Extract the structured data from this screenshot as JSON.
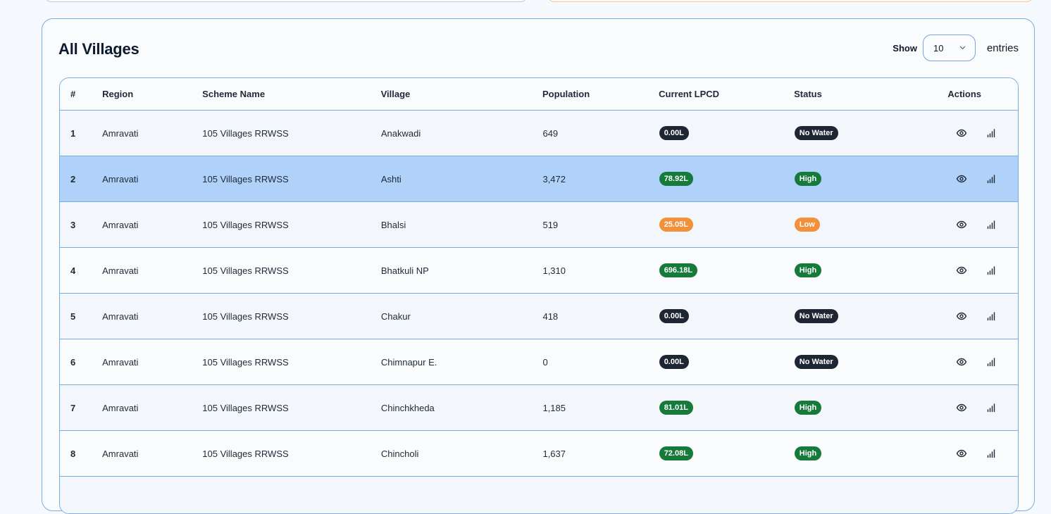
{
  "panel": {
    "title": "All Villages",
    "show_label": "Show",
    "entries_value": "10",
    "entries_label": "entries"
  },
  "table": {
    "headers": {
      "num": "#",
      "region": "Region",
      "scheme": "Scheme Name",
      "village": "Village",
      "population": "Population",
      "lpcd": "Current LPCD",
      "status": "Status",
      "actions": "Actions"
    },
    "rows": [
      {
        "num": "1",
        "region": "Amravati",
        "scheme": "105 Villages RRWSS",
        "village": "Anakwadi",
        "population": "649",
        "lpcd": "0.00L",
        "lpcd_color": "#1e2633",
        "status": "No Water",
        "status_color": "#1e2633"
      },
      {
        "num": "2",
        "region": "Amravati",
        "scheme": "105 Villages RRWSS",
        "village": "Ashti",
        "population": "3,472",
        "lpcd": "78.92L",
        "lpcd_color": "#157a3a",
        "status": "High",
        "status_color": "#157a3a"
      },
      {
        "num": "3",
        "region": "Amravati",
        "scheme": "105 Villages RRWSS",
        "village": "Bhalsi",
        "population": "519",
        "lpcd": "25.05L",
        "lpcd_color": "#f3913b",
        "status": "Low",
        "status_color": "#f3913b"
      },
      {
        "num": "4",
        "region": "Amravati",
        "scheme": "105 Villages RRWSS",
        "village": "Bhatkuli NP",
        "population": "1,310",
        "lpcd": "696.18L",
        "lpcd_color": "#157a3a",
        "status": "High",
        "status_color": "#157a3a"
      },
      {
        "num": "5",
        "region": "Amravati",
        "scheme": "105 Villages RRWSS",
        "village": "Chakur",
        "population": "418",
        "lpcd": "0.00L",
        "lpcd_color": "#1e2633",
        "status": "No Water",
        "status_color": "#1e2633"
      },
      {
        "num": "6",
        "region": "Amravati",
        "scheme": "105 Villages RRWSS",
        "village": "Chimnapur E.",
        "population": "0",
        "lpcd": "0.00L",
        "lpcd_color": "#1e2633",
        "status": "No Water",
        "status_color": "#1e2633"
      },
      {
        "num": "7",
        "region": "Amravati",
        "scheme": "105 Villages RRWSS",
        "village": "Chinchkheda",
        "population": "1,185",
        "lpcd": "81.01L",
        "lpcd_color": "#157a3a",
        "status": "High",
        "status_color": "#157a3a"
      },
      {
        "num": "8",
        "region": "Amravati",
        "scheme": "105 Villages RRWSS",
        "village": "Chincholi",
        "population": "1,637",
        "lpcd": "72.08L",
        "lpcd_color": "#157a3a",
        "status": "High",
        "status_color": "#157a3a"
      }
    ],
    "selected_row": "2",
    "row_icons": [
      "eye-icon",
      "bar-chart-icon"
    ]
  }
}
